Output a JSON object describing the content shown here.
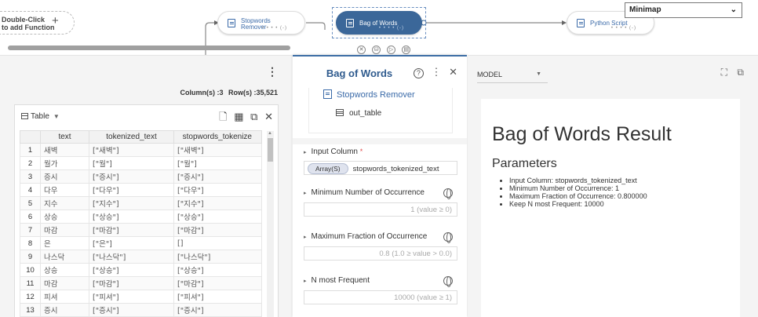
{
  "canvas": {
    "add_function": "Double-Click\nto add Function",
    "add_plus": "+",
    "nodes": [
      {
        "label": "Stopwords\nRemover",
        "dots": "• • • • (-)"
      },
      {
        "label": "Bag of Words",
        "dots": "• • • • (-)"
      },
      {
        "label": "Python Script",
        "dots": "• • • • (-)"
      }
    ],
    "tools": [
      "✕",
      "⛁",
      "▷",
      "▤"
    ],
    "minimap": {
      "label": "Minimap",
      "chevron": "⌄"
    }
  },
  "left_panel": {
    "menu_icon": "⋮",
    "columns_label": "Column(s) :3",
    "rows_label": "Row(s) :35,521",
    "table_view": {
      "title": "Table",
      "dropdown_icon": "▼",
      "icons": [
        "🗋",
        "▦",
        "⧉",
        "✕"
      ],
      "headers": [
        "",
        "text",
        "tokenized_text",
        "stopwords_tokenize"
      ],
      "rows": [
        [
          "1",
          "새벽",
          "[\"새벽\"]",
          "[\"새벽\"]"
        ],
        [
          "2",
          "월가",
          "[\"월\"]",
          "[\"월\"]"
        ],
        [
          "3",
          "증시",
          "[\"증시\"]",
          "[\"증시\"]"
        ],
        [
          "4",
          "다우",
          "[\"다우\"]",
          "[\"다우\"]"
        ],
        [
          "5",
          "지수",
          "[\"지수\"]",
          "[\"지수\"]"
        ],
        [
          "6",
          "상승",
          "[\"상승\"]",
          "[\"상승\"]"
        ],
        [
          "7",
          "마감",
          "[\"마감\"]",
          "[\"마감\"]"
        ],
        [
          "8",
          "은",
          "[\"은\"]",
          "[]"
        ],
        [
          "9",
          "나스닥",
          "[\"나스닥\"]",
          "[\"나스닥\"]"
        ],
        [
          "10",
          "상승",
          "[\"상승\"]",
          "[\"상승\"]"
        ],
        [
          "11",
          "마감",
          "[\"마감\"]",
          "[\"마감\"]"
        ],
        [
          "12",
          "피셔",
          "[\"피셔\"]",
          "[\"피셔\"]"
        ],
        [
          "13",
          "증시",
          "[\"증시\"]",
          "[\"증시\"]"
        ]
      ]
    }
  },
  "mid_panel": {
    "title": "Bag of Words",
    "help_icon": "?",
    "menu_icon": "⋮",
    "close_icon": "✕",
    "input_function": "Stopwords Remover",
    "output_table": "out_table",
    "params": {
      "input_column": {
        "label": "Input Column",
        "required": "*",
        "chip": "Array(S)",
        "value": "stopwords_tokenized_text"
      },
      "min_occurrence": {
        "label": "Minimum Number of Occurrence",
        "placeholder": "1 (value ≥ 0)"
      },
      "max_fraction": {
        "label": "Maximum Fraction of Occurrence",
        "placeholder": "0.8 (1.0 ≥ value > 0.0)"
      },
      "n_most": {
        "label": "N most Frequent",
        "placeholder": "10000 (value ≥ 1)"
      }
    },
    "arrow": "▸"
  },
  "right_panel": {
    "selector": {
      "value": "MODEL",
      "dropdown_icon": "▼"
    },
    "icons": [
      "⛶",
      "⧉"
    ],
    "result": {
      "title": "Bag of Words Result",
      "subtitle": "Parameters",
      "items": [
        "Input Column: stopwords_tokenized_text",
        "Minimum Number of Occurrence: 1",
        "Maximum Fraction of Occurrence: 0.800000",
        "Keep N most Frequent: 10000"
      ]
    }
  },
  "colors": {
    "accent": "#3b6799",
    "accent_text": "#2f5b8e",
    "required": "#e04b4b",
    "panel_bg": "#f4f4f4"
  }
}
